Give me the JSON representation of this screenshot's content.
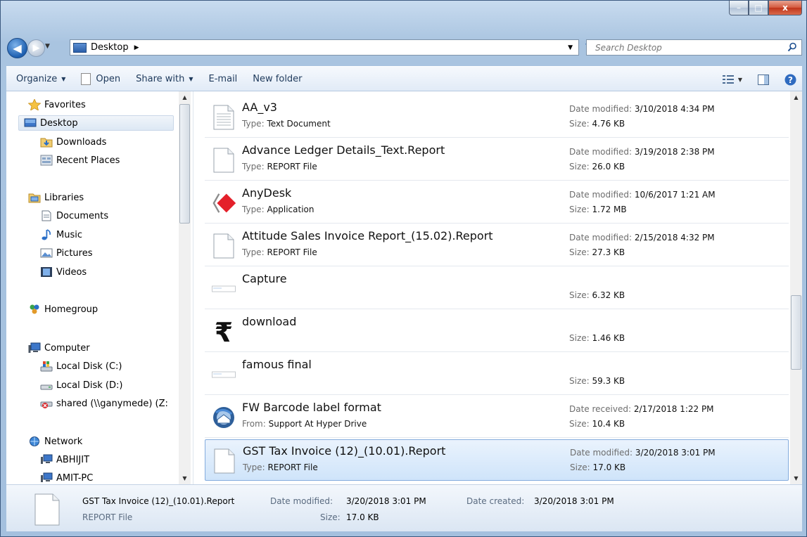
{
  "window": {
    "controls": {
      "minimize": "–",
      "maximize": "□",
      "close": "x"
    }
  },
  "nav": {
    "back_glyph": "◀",
    "forward_glyph": "▶",
    "address_crumb": "Desktop",
    "search_placeholder": "Search Desktop"
  },
  "toolbar": {
    "organize": "Organize",
    "open": "Open",
    "share_with": "Share with",
    "email": "E-mail",
    "new_folder": "New folder"
  },
  "sidebar": {
    "items": [
      {
        "label": "Favorites",
        "icon": "star-icon"
      },
      {
        "label": "Desktop",
        "icon": "desktop-icon"
      },
      {
        "label": "Downloads",
        "icon": "downloads-folder-icon"
      },
      {
        "label": "Recent Places",
        "icon": "recent-places-icon"
      },
      {
        "label": "Libraries",
        "icon": "libraries-icon"
      },
      {
        "label": "Documents",
        "icon": "documents-icon"
      },
      {
        "label": "Music",
        "icon": "music-icon"
      },
      {
        "label": "Pictures",
        "icon": "pictures-icon"
      },
      {
        "label": "Videos",
        "icon": "videos-icon"
      },
      {
        "label": "Homegroup",
        "icon": "homegroup-icon"
      },
      {
        "label": "Computer",
        "icon": "computer-icon"
      },
      {
        "label": "Local Disk (C:)",
        "icon": "drive-c-icon"
      },
      {
        "label": "Local Disk (D:)",
        "icon": "drive-d-icon"
      },
      {
        "label": "shared (\\\\ganymede) (Z:",
        "icon": "network-drive-disconnected-icon"
      },
      {
        "label": "Network",
        "icon": "network-icon"
      },
      {
        "label": "ABHIJIT",
        "icon": "network-computer-icon"
      },
      {
        "label": "AMIT-PC",
        "icon": "network-computer-icon"
      }
    ]
  },
  "files": [
    {
      "name": "AA_v3",
      "type_label": "Type:",
      "type": "Text Document",
      "date_label": "Date modified:",
      "date": "3/10/2018 4:34 PM",
      "size_label": "Size:",
      "size": "4.76 KB",
      "icon": "text-document-icon"
    },
    {
      "name": "Advance Ledger Details_Text.Report",
      "type_label": "Type:",
      "type": "REPORT File",
      "date_label": "Date modified:",
      "date": "3/19/2018 2:38 PM",
      "size_label": "Size:",
      "size": "26.0 KB",
      "icon": "blank-file-icon"
    },
    {
      "name": "AnyDesk",
      "type_label": "Type:",
      "type": "Application",
      "date_label": "Date modified:",
      "date": "10/6/2017 1:21 AM",
      "size_label": "Size:",
      "size": "1.72 MB",
      "icon": "anydesk-icon"
    },
    {
      "name": "Attitude Sales Invoice  Report_(15.02).Report",
      "type_label": "Type:",
      "type": "REPORT File",
      "date_label": "Date modified:",
      "date": "2/15/2018 4:32 PM",
      "size_label": "Size:",
      "size": "27.3 KB",
      "icon": "blank-file-icon"
    },
    {
      "name": "Capture",
      "type_label": "",
      "type": "",
      "date_label": "",
      "date": "",
      "size_label": "Size:",
      "size": "6.32 KB",
      "icon": "image-thumbnail-icon"
    },
    {
      "name": "download",
      "type_label": "",
      "type": "",
      "date_label": "",
      "date": "",
      "size_label": "Size:",
      "size": "1.46 KB",
      "icon": "rupee-image-icon"
    },
    {
      "name": "famous final",
      "type_label": "",
      "type": "",
      "date_label": "",
      "date": "",
      "size_label": "Size:",
      "size": "59.3 KB",
      "icon": "image-thumbnail-icon"
    },
    {
      "name": "FW Barcode label format",
      "type_label": "From:",
      "type": "Support At Hyper Drive",
      "date_label": "Date received:",
      "date": "2/17/2018 1:22 PM",
      "size_label": "Size:",
      "size": "10.4 KB",
      "icon": "thunderbird-mail-icon"
    },
    {
      "name": "GST Tax Invoice (12)_(10.01).Report",
      "type_label": "Type:",
      "type": "REPORT File",
      "date_label": "Date modified:",
      "date": "3/20/2018 3:01 PM",
      "size_label": "Size:",
      "size": "17.0 KB",
      "icon": "blank-file-icon"
    }
  ],
  "details": {
    "name": "GST Tax Invoice (12)_(10.01).Report",
    "type": "REPORT File",
    "date_modified_label": "Date modified:",
    "date_modified": "3/20/2018 3:01 PM",
    "date_created_label": "Date created:",
    "date_created": "3/20/2018 3:01 PM",
    "size_label": "Size:",
    "size": "17.0 KB"
  },
  "colors": {
    "selection": "#cfe4fa",
    "selection_border": "#84acdd",
    "toolbar_text": "#1e395b"
  }
}
